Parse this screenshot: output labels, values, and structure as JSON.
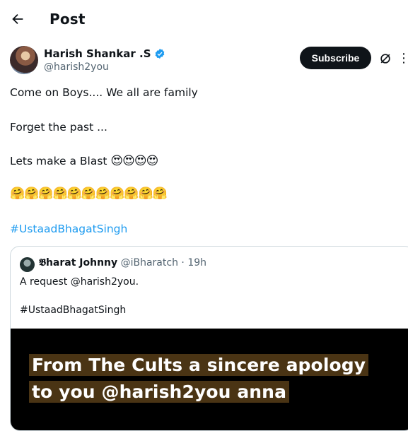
{
  "header": {
    "title": "Post",
    "back_icon": "arrow-left-icon"
  },
  "author": {
    "name": "Harish Shankar .S",
    "handle": "@harish2you",
    "verified_color": "#1d9bf0",
    "subscribe_label": "Subscribe"
  },
  "post": {
    "line1": "Come on Boys.... We all are family",
    "line2": "Forget the past ...",
    "line3_text": "Lets make a Blast ",
    "line3_emoji": "😍😍😍😍",
    "hug_emojis": "🤗🤗🤗🤗🤗🤗🤗🤗🤗🤗🤗",
    "hashtag": "#UstaadBhagatSingh"
  },
  "quote": {
    "name": "𝕭harat Johnny",
    "handle": "@iBharatch",
    "separator": "·",
    "time": "19h",
    "text": "A request @harish2you.",
    "hashtag": "#UstaadBhagatSingh",
    "media_caption_line1": "From The Cults a sincere apology",
    "media_caption_line2": "to you @harish2you anna"
  },
  "colors": {
    "accent": "#1d9bf0",
    "text": "#0f1419",
    "muted": "#536471",
    "border": "#cfd9de"
  }
}
